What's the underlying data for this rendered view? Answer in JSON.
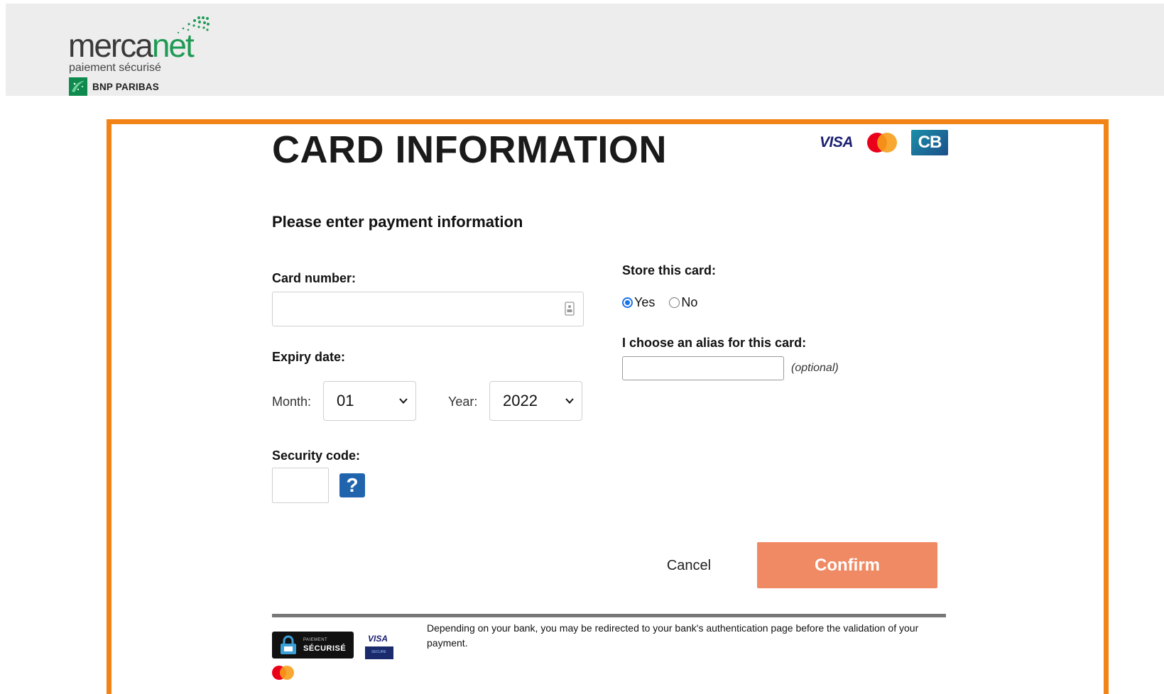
{
  "header": {
    "logo_word_left": "merca",
    "logo_word_right": "net",
    "logo_tagline": "paiement sécurisé",
    "bank_name": "BNP PARIBAS"
  },
  "page": {
    "title": "CARD INFORMATION",
    "subtitle": "Please enter payment information"
  },
  "card_brands": {
    "visa": "VISA",
    "cb": "CB"
  },
  "form": {
    "card_number_label": "Card number:",
    "card_number_value": "",
    "expiry_label": "Expiry date:",
    "month_label": "Month:",
    "month_value": "01",
    "year_label": "Year:",
    "year_value": "2022",
    "security_code_label": "Security code:",
    "security_code_value": "",
    "help_label": "?",
    "store_card_label": "Store this card:",
    "store_yes": "Yes",
    "store_no": "No",
    "store_selected": "Yes",
    "alias_label": "I choose an alias for this card:",
    "alias_value": "",
    "alias_hint": "(optional)"
  },
  "actions": {
    "cancel_label": "Cancel",
    "confirm_label": "Confirm"
  },
  "footer": {
    "badge_small": "PAIEMENT",
    "badge_big": "SÉCURISÉ",
    "visa_secure_top": "VISA",
    "visa_secure_bottom": "SECURE",
    "notice": "Depending on your bank, you may be redirected to your bank's authentication page before the validation of your payment."
  },
  "colors": {
    "frame_border": "#f28417",
    "confirm_button": "#f08a64",
    "help_button": "#1f64ad",
    "brand_green": "#1f9a55",
    "header_bg": "#ededed"
  }
}
